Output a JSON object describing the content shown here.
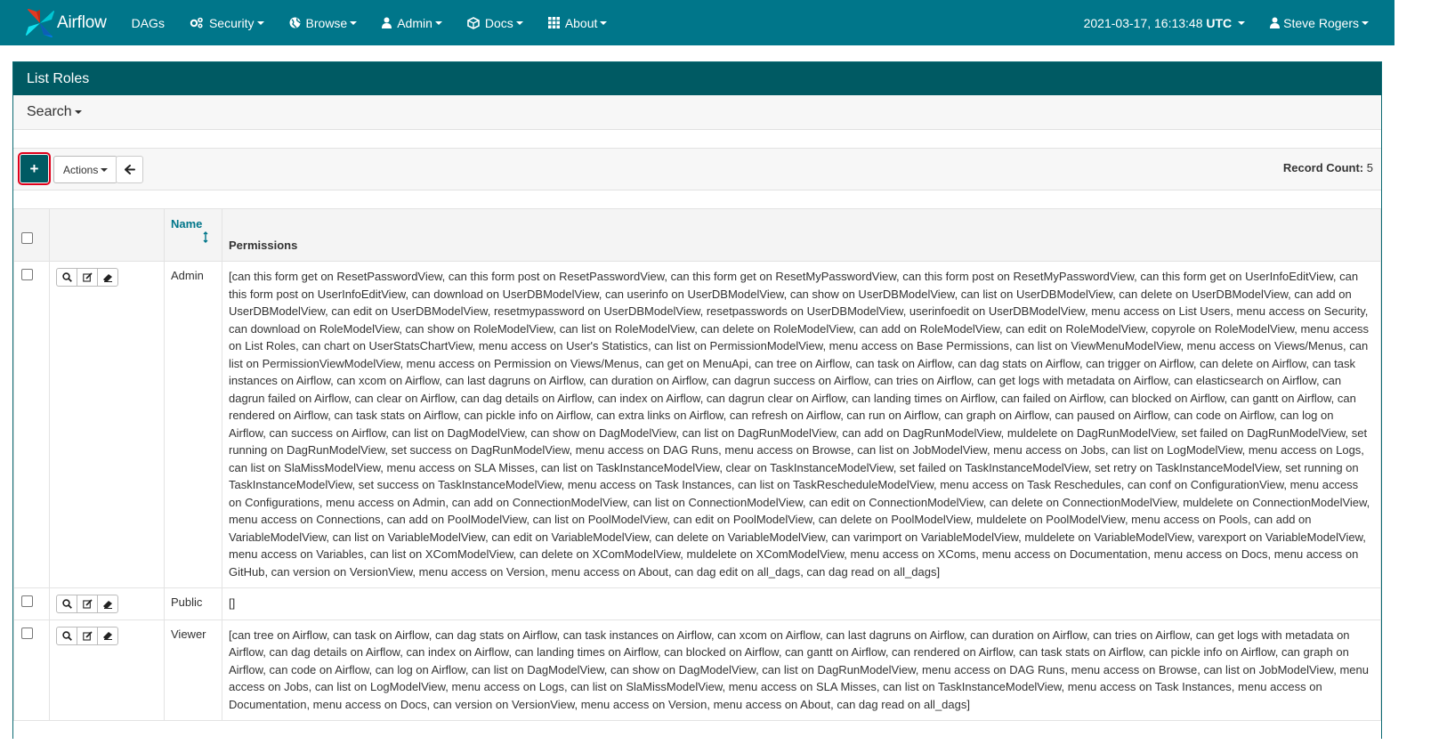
{
  "brand": {
    "name": "Airflow"
  },
  "nav": {
    "dags": "DAGs",
    "security": "Security",
    "browse": "Browse",
    "admin": "Admin",
    "docs": "Docs",
    "about": "About"
  },
  "nav_right": {
    "datetime": "2021-03-17, 16:13:48",
    "tz": "UTC",
    "user": "Steve Rogers"
  },
  "page": {
    "title": "List Roles",
    "search_label": "Search",
    "add_label": "+",
    "actions_label": "Actions",
    "record_count_label": "Record Count:",
    "record_count": "5"
  },
  "table": {
    "columns": {
      "name": "Name",
      "permissions": "Permissions"
    },
    "rows": [
      {
        "name": "Admin",
        "permissions": "[can this form get on ResetPasswordView, can this form post on ResetPasswordView, can this form get on ResetMyPasswordView, can this form post on ResetMyPasswordView, can this form get on UserInfoEditView, can this form post on UserInfoEditView, can download on UserDBModelView, can userinfo on UserDBModelView, can show on UserDBModelView, can list on UserDBModelView, can delete on UserDBModelView, can add on UserDBModelView, can edit on UserDBModelView, resetmypassword on UserDBModelView, resetpasswords on UserDBModelView, userinfoedit on UserDBModelView, menu access on List Users, menu access on Security, can download on RoleModelView, can show on RoleModelView, can list on RoleModelView, can delete on RoleModelView, can add on RoleModelView, can edit on RoleModelView, copyrole on RoleModelView, menu access on List Roles, can chart on UserStatsChartView, menu access on User's Statistics, can list on PermissionModelView, menu access on Base Permissions, can list on ViewMenuModelView, menu access on Views/Menus, can list on PermissionViewModelView, menu access on Permission on Views/Menus, can get on MenuApi, can tree on Airflow, can task on Airflow, can dag stats on Airflow, can trigger on Airflow, can delete on Airflow, can task instances on Airflow, can xcom on Airflow, can last dagruns on Airflow, can duration on Airflow, can dagrun success on Airflow, can tries on Airflow, can get logs with metadata on Airflow, can elasticsearch on Airflow, can dagrun failed on Airflow, can clear on Airflow, can dag details on Airflow, can index on Airflow, can dagrun clear on Airflow, can landing times on Airflow, can failed on Airflow, can blocked on Airflow, can gantt on Airflow, can rendered on Airflow, can task stats on Airflow, can pickle info on Airflow, can extra links on Airflow, can refresh on Airflow, can run on Airflow, can graph on Airflow, can paused on Airflow, can code on Airflow, can log on Airflow, can success on Airflow, can list on DagModelView, can show on DagModelView, can list on DagRunModelView, can add on DagRunModelView, muldelete on DagRunModelView, set failed on DagRunModelView, set running on DagRunModelView, set success on DagRunModelView, menu access on DAG Runs, menu access on Browse, can list on JobModelView, menu access on Jobs, can list on LogModelView, menu access on Logs, can list on SlaMissModelView, menu access on SLA Misses, can list on TaskInstanceModelView, clear on TaskInstanceModelView, set failed on TaskInstanceModelView, set retry on TaskInstanceModelView, set running on TaskInstanceModelView, set success on TaskInstanceModelView, menu access on Task Instances, can list on TaskRescheduleModelView, menu access on Task Reschedules, can conf on ConfigurationView, menu access on Configurations, menu access on Admin, can add on ConnectionModelView, can list on ConnectionModelView, can edit on ConnectionModelView, can delete on ConnectionModelView, muldelete on ConnectionModelView, menu access on Connections, can add on PoolModelView, can list on PoolModelView, can edit on PoolModelView, can delete on PoolModelView, muldelete on PoolModelView, menu access on Pools, can add on VariableModelView, can list on VariableModelView, can edit on VariableModelView, can delete on VariableModelView, can varimport on VariableModelView, muldelete on VariableModelView, varexport on VariableModelView, menu access on Variables, can list on XComModelView, can delete on XComModelView, muldelete on XComModelView, menu access on XComs, menu access on Documentation, menu access on Docs, menu access on GitHub, can version on VersionView, menu access on Version, menu access on About, can dag edit on all_dags, can dag read on all_dags]"
      },
      {
        "name": "Public",
        "permissions": "[]"
      },
      {
        "name": "Viewer",
        "permissions": "[can tree on Airflow, can task on Airflow, can dag stats on Airflow, can task instances on Airflow, can xcom on Airflow, can last dagruns on Airflow, can duration on Airflow, can tries on Airflow, can get logs with metadata on Airflow, can dag details on Airflow, can index on Airflow, can landing times on Airflow, can blocked on Airflow, can gantt on Airflow, can rendered on Airflow, can task stats on Airflow, can pickle info on Airflow, can graph on Airflow, can code on Airflow, can log on Airflow, can list on DagModelView, can show on DagModelView, can list on DagRunModelView, menu access on DAG Runs, menu access on Browse, can list on JobModelView, menu access on Jobs, can list on LogModelView, menu access on Logs, can list on SlaMissModelView, menu access on SLA Misses, can list on TaskInstanceModelView, menu access on Task Instances, menu access on Documentation, menu access on Docs, can version on VersionView, menu access on Version, menu access on About, can dag read on all_dags]"
      }
    ]
  },
  "colors": {
    "navbar": "#00768a",
    "panel_heading": "#005a63",
    "highlight": "#e0001b"
  }
}
